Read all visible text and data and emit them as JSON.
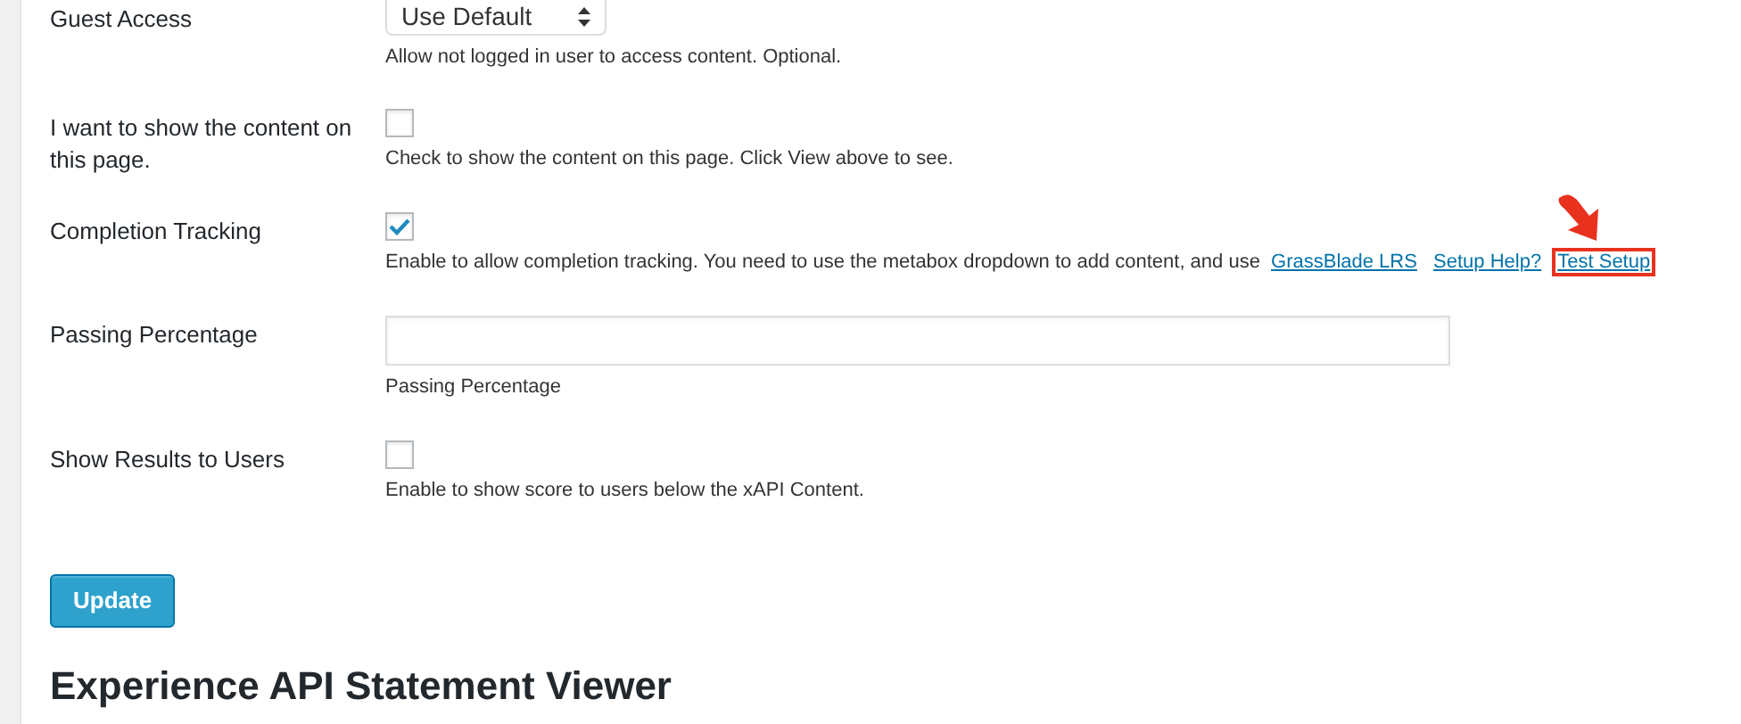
{
  "fields": [
    {
      "kind": "select",
      "label": "Guest Access",
      "value": "Use Default",
      "help": "Allow not logged in user to access content. Optional."
    },
    {
      "kind": "checkbox",
      "label": "I want to show the content on this page.",
      "checked": false,
      "help": "Check to show the content on this page. Click View above to see."
    },
    {
      "kind": "checkbox",
      "label": "Completion Tracking",
      "checked": true,
      "help": "Enable to allow completion tracking. You need to use the metabox dropdown to add content, and use",
      "links": [
        {
          "text": "GrassBlade LRS",
          "highlighted": false
        },
        {
          "text": "Setup Help?",
          "highlighted": false
        },
        {
          "text": "Test Setup",
          "highlighted": true
        }
      ]
    },
    {
      "kind": "text",
      "label": "Passing Percentage",
      "help": "Passing Percentage"
    },
    {
      "kind": "checkbox",
      "label": "Show Results to Users",
      "checked": false,
      "help": "Enable to show score to users below the xAPI Content."
    }
  ],
  "update_button": "Update",
  "heading": "Experience API Statement Viewer"
}
